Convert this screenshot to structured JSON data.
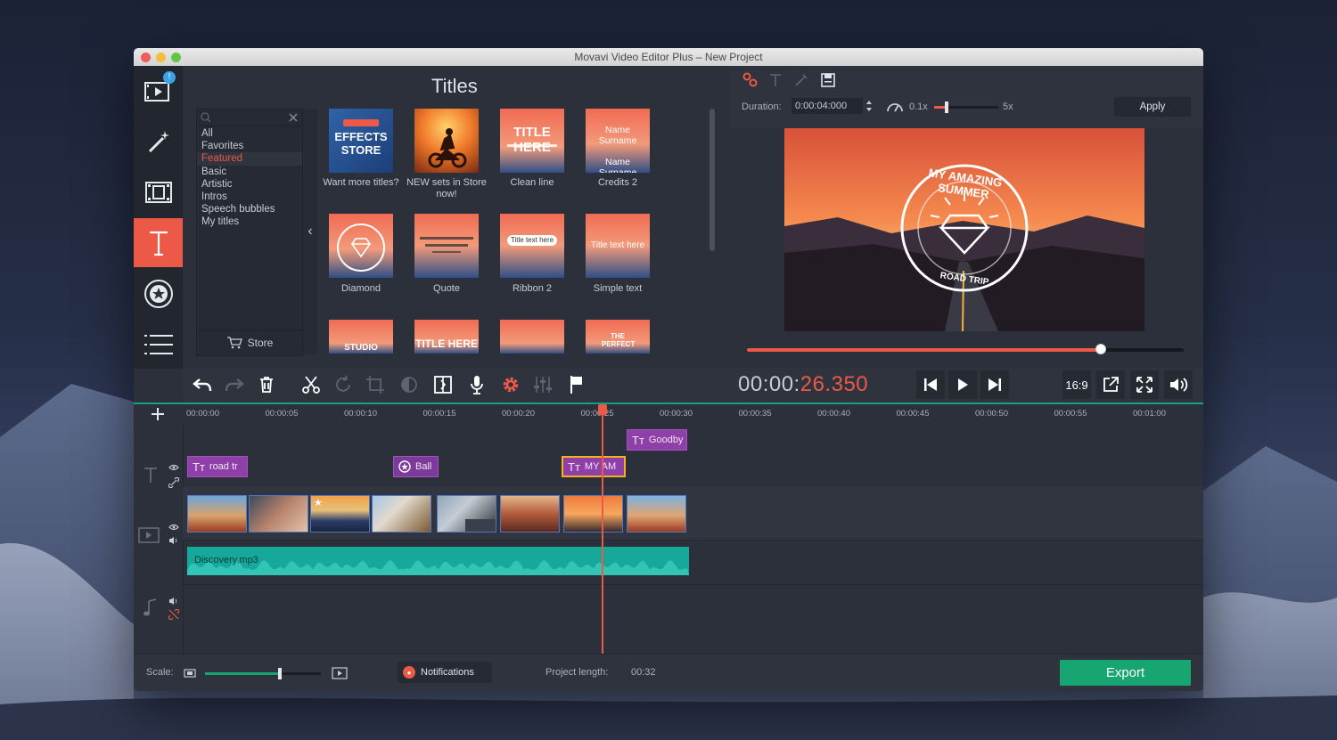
{
  "window": {
    "title": "Movavi Video Editor Plus – New Project"
  },
  "sidebar": {
    "badge": "!"
  },
  "gallery": {
    "title": "Titles",
    "categories": [
      "All",
      "Favorites",
      "Featured",
      "Basic",
      "Artistic",
      "Intros",
      "Speech bubbles",
      "My titles"
    ],
    "store_label": "Store",
    "tiles": [
      {
        "caption": "Want more titles?",
        "art": "EFFECTS STORE"
      },
      {
        "caption": "NEW sets in Store now!",
        "art": ""
      },
      {
        "caption": "Clean line",
        "art": "TITLE HERE"
      },
      {
        "caption": "Credits 2",
        "art": "Name Surname"
      },
      {
        "caption": "Diamond",
        "art": ""
      },
      {
        "caption": "Quote",
        "art": ""
      },
      {
        "caption": "Ribbon 2",
        "art": "Title text here"
      },
      {
        "caption": "Simple text",
        "art": "Title text here"
      },
      {
        "caption": "",
        "art": "STUDIO"
      },
      {
        "caption": "",
        "art": "TITLE HERE"
      },
      {
        "caption": "",
        "art": ""
      },
      {
        "caption": "",
        "art": "THE PERFECT"
      }
    ]
  },
  "preview": {
    "duration_label": "Duration:",
    "duration_value": "0:00:04:000",
    "speed_min": "0.1x",
    "speed_max": "5x",
    "apply_label": "Apply",
    "overlay_line1": "MY AMAZING SUMMER",
    "overlay_line2": "ROAD TRIP",
    "progress": 0.81,
    "timecode_main": "00:00:",
    "timecode_red": "26.350",
    "aspect": "16:9"
  },
  "timeline": {
    "ruler": [
      "00:00:00",
      "00:00:05",
      "00:00:10",
      "00:00:15",
      "00:00:20",
      "00:00:25",
      "00:00:30",
      "00:00:35",
      "00:00:40",
      "00:00:45",
      "00:00:50",
      "00:00:55",
      "00:01:00"
    ],
    "title_clips": [
      "road tr",
      "Ball",
      "MY AM",
      "Goodby"
    ],
    "audio_label": "Discovery.mp3"
  },
  "bottom": {
    "scale_label": "Scale:",
    "notifications_label": "Notifications",
    "project_length_label": "Project length:",
    "project_length_value": "00:32",
    "export_label": "Export"
  },
  "colors": {
    "accent": "#ec5a47",
    "export": "#17a572",
    "audio": "#16a89a",
    "title_clip": "#8e3fa8"
  }
}
